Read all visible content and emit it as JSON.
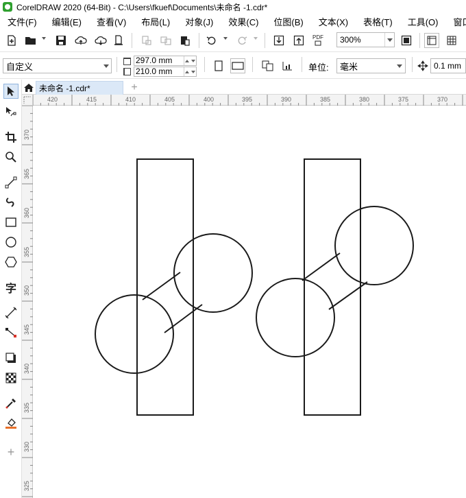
{
  "window": {
    "title": "CorelDRAW 2020 (64-Bit) - C:\\Users\\fkuef\\Documents\\未命名 -1.cdr*"
  },
  "menu": {
    "items": [
      "文件(F)",
      "编辑(E)",
      "查看(V)",
      "布局(L)",
      "对象(J)",
      "效果(C)",
      "位图(B)",
      "文本(X)",
      "表格(T)",
      "工具(O)",
      "窗口"
    ]
  },
  "toolbar": {
    "zoom": "300%",
    "pdf_label": "PDF"
  },
  "property_bar": {
    "page_preset": "自定义",
    "width": "297.0 mm",
    "height": "210.0 mm",
    "units_label": "单位:",
    "units": "毫米",
    "nudge": "0.1 mm"
  },
  "tabs": {
    "document": "未命名 -1.cdr*",
    "add": "+"
  },
  "toolbox": {
    "text_tool_glyph": "字",
    "add_glyph": "+"
  },
  "rulers": {
    "horizontal_ticks": [
      "420",
      "415",
      "410",
      "405",
      "400",
      "395",
      "390",
      "385",
      "380",
      "375",
      "370"
    ],
    "vertical_ticks": [
      "370",
      "365",
      "360",
      "355",
      "350",
      "345",
      "340",
      "335",
      "330",
      "325"
    ]
  },
  "colors": {
    "accent": "#2fa02f",
    "tab_active": "#dbe8f7",
    "stroke": "#1a1a1a"
  }
}
